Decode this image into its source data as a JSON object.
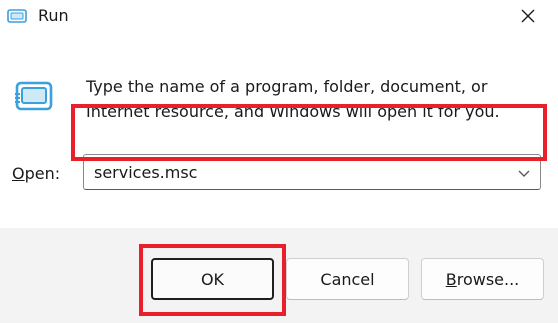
{
  "window": {
    "title": "Run",
    "title_icon": "run-app-icon",
    "close_icon": "close-icon"
  },
  "content": {
    "icon": "run-app-icon",
    "description": "Type the name of a program, folder, document, or Internet resource, and Windows will open it for you."
  },
  "open_field": {
    "label_accesskey": "O",
    "label_rest": "pen:",
    "value": "services.msc",
    "dropdown_icon": "chevron-down-icon"
  },
  "buttons": {
    "ok": "OK",
    "cancel": "Cancel",
    "browse_accesskey": "B",
    "browse_rest": "rowse..."
  },
  "annotations": {
    "highlight_color": "#e8202a",
    "highlighted": [
      "open-field",
      "ok-button"
    ]
  },
  "colors": {
    "footer_bg": "#f3f3f3",
    "icon_blue": "#3aa0de"
  }
}
